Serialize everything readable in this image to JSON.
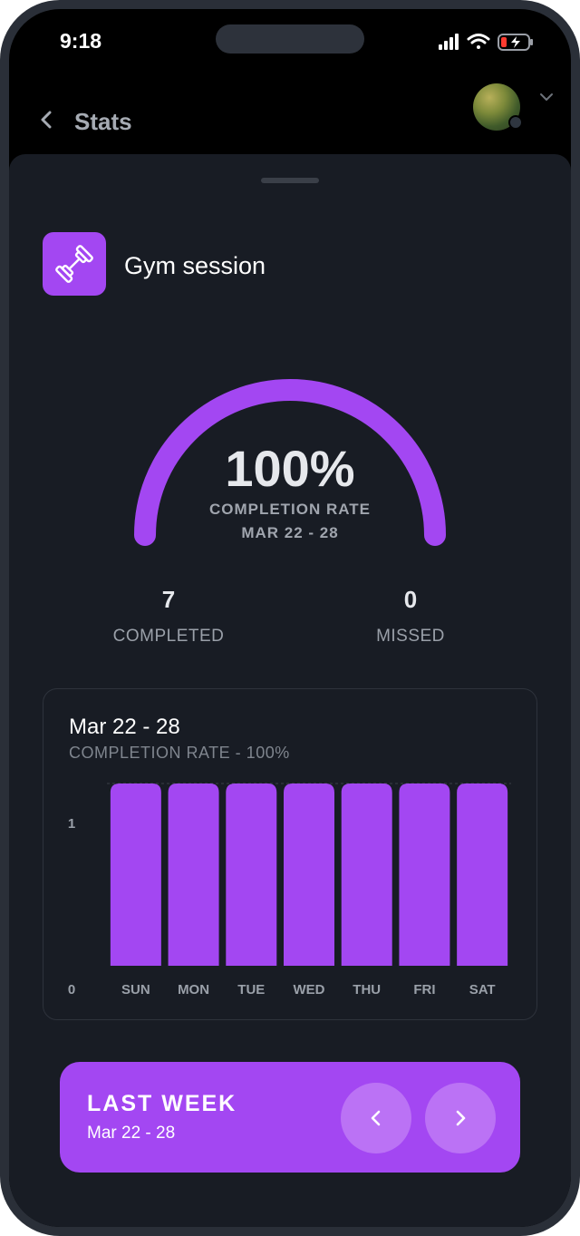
{
  "status_bar": {
    "time": "9:18"
  },
  "header": {
    "title": "Stats"
  },
  "habit": {
    "name": "Gym session",
    "icon": "dumbbell-icon"
  },
  "summary": {
    "completion_rate_value": "100%",
    "completion_rate_fraction": 1.0,
    "completion_rate_label": "COMPLETION RATE",
    "date_range": "MAR 22 - 28",
    "completed_count": "7",
    "completed_label": "COMPLETED",
    "missed_count": "0",
    "missed_label": "MISSED"
  },
  "chart_card": {
    "title": "Mar 22 - 28",
    "subtitle": "COMPLETION RATE - 100%"
  },
  "chart_data": {
    "type": "bar",
    "categories": [
      "SUN",
      "MON",
      "TUE",
      "WED",
      "THU",
      "FRI",
      "SAT"
    ],
    "values": [
      1,
      1,
      1,
      1,
      1,
      1,
      1
    ],
    "ylim": [
      0,
      1
    ],
    "yticks": [
      "0",
      "1"
    ],
    "bar_color": "#a347f2"
  },
  "week_nav": {
    "title": "LAST WEEK",
    "range": "Mar 22 - 28"
  },
  "colors": {
    "accent": "#a347f2",
    "background": "#181c24"
  }
}
